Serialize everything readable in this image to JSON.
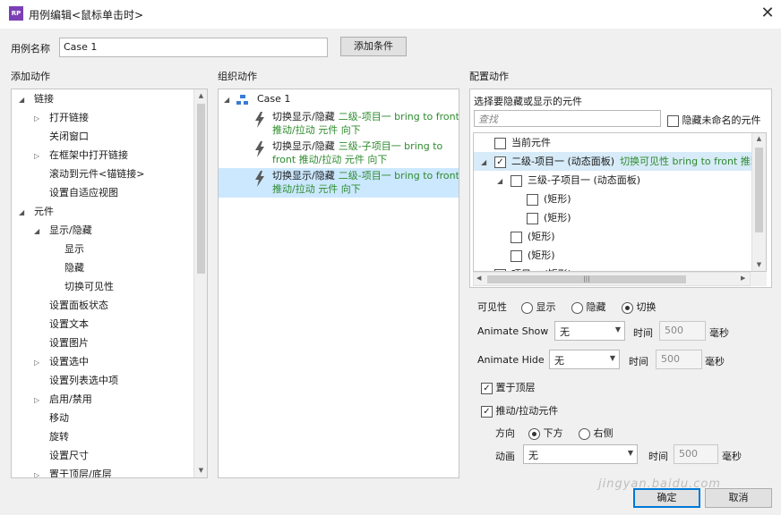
{
  "window": {
    "title": "用例编辑<鼠标单击时>",
    "app_icon": "RP"
  },
  "case_name": {
    "label": "用例名称",
    "value": "Case 1",
    "add_condition": "添加条件"
  },
  "sections": {
    "add_action": "添加动作",
    "organize_action": "组织动作",
    "config_action": "配置动作"
  },
  "add_action_tree": [
    {
      "label": "链接",
      "level": 0,
      "toggle": "expanded"
    },
    {
      "label": "打开链接",
      "level": 1,
      "toggle": "collapsed"
    },
    {
      "label": "关闭窗口",
      "level": 1,
      "toggle": "none"
    },
    {
      "label": "在框架中打开链接",
      "level": 1,
      "toggle": "collapsed"
    },
    {
      "label": "滚动到元件<锚链接>",
      "level": 1,
      "toggle": "none"
    },
    {
      "label": "设置自适应视图",
      "level": 1,
      "toggle": "none"
    },
    {
      "label": "元件",
      "level": 0,
      "toggle": "expanded"
    },
    {
      "label": "显示/隐藏",
      "level": 1,
      "toggle": "expanded"
    },
    {
      "label": "显示",
      "level": 2,
      "toggle": "none"
    },
    {
      "label": "隐藏",
      "level": 2,
      "toggle": "none"
    },
    {
      "label": "切换可见性",
      "level": 2,
      "toggle": "none"
    },
    {
      "label": "设置面板状态",
      "level": 1,
      "toggle": "none"
    },
    {
      "label": "设置文本",
      "level": 1,
      "toggle": "none"
    },
    {
      "label": "设置图片",
      "level": 1,
      "toggle": "none"
    },
    {
      "label": "设置选中",
      "level": 1,
      "toggle": "collapsed"
    },
    {
      "label": "设置列表选中项",
      "level": 1,
      "toggle": "none"
    },
    {
      "label": "启用/禁用",
      "level": 1,
      "toggle": "collapsed"
    },
    {
      "label": "移动",
      "level": 1,
      "toggle": "none"
    },
    {
      "label": "旋转",
      "level": 1,
      "toggle": "none"
    },
    {
      "label": "设置尺寸",
      "level": 1,
      "toggle": "none"
    },
    {
      "label": "置于顶层/底层",
      "level": 1,
      "toggle": "collapsed"
    }
  ],
  "organize": {
    "case_label": "Case 1",
    "actions": [
      {
        "prefix": "切换显示/隐藏",
        "target": "二级-项目一 bring to front",
        "line2": "推动/拉动 元件 向下",
        "selected": false
      },
      {
        "prefix": "切换显示/隐藏",
        "target": "三级-子项目一 bring to",
        "line2": "front 推动/拉动 元件 向下",
        "selected": false
      },
      {
        "prefix": "切换显示/隐藏",
        "target": "二级-项目一 bring to front",
        "line2": "推动/拉动 元件 向下",
        "selected": true
      }
    ]
  },
  "config": {
    "select_label": "选择要隐藏或显示的元件",
    "search_placeholder": "查找",
    "hide_unnamed": "隐藏未命名的元件",
    "widgets": [
      {
        "label": "当前元件",
        "extra": "",
        "level": 0,
        "checked": false,
        "toggle": "none"
      },
      {
        "label": "二级-项目一 (动态面板)",
        "extra": "切换可见性 bring to front 推动/拉",
        "level": 0,
        "checked": true,
        "toggle": "expanded"
      },
      {
        "label": "三级-子项目一 (动态面板)",
        "extra": "",
        "level": 1,
        "checked": false,
        "toggle": "expanded"
      },
      {
        "label": "(矩形)",
        "extra": "",
        "level": 2,
        "checked": false,
        "toggle": "none"
      },
      {
        "label": "(矩形)",
        "extra": "",
        "level": 2,
        "checked": false,
        "toggle": "none"
      },
      {
        "label": "(矩形)",
        "extra": "",
        "level": 1,
        "checked": false,
        "toggle": "none"
      },
      {
        "label": "(矩形)",
        "extra": "",
        "level": 1,
        "checked": false,
        "toggle": "none"
      },
      {
        "label": "项目一 (矩形)",
        "extra": "",
        "level": 0,
        "checked": false,
        "toggle": "none"
      }
    ],
    "visibility": {
      "label": "可见性",
      "options": [
        "显示",
        "隐藏",
        "切换"
      ],
      "selected": "切换"
    },
    "animate_show": {
      "label": "Animate Show",
      "value": "无",
      "time_label": "时间",
      "time_value": "500",
      "unit": "毫秒"
    },
    "animate_hide": {
      "label": "Animate Hide",
      "value": "无",
      "time_label": "时间",
      "time_value": "500",
      "unit": "毫秒"
    },
    "bring_to_front": {
      "label": "置于顶层",
      "checked": true
    },
    "push_pull": {
      "label": "推动/拉动元件",
      "checked": true
    },
    "direction": {
      "label": "方向",
      "options": [
        "下方",
        "右侧"
      ],
      "selected": "下方"
    },
    "animation": {
      "label": "动画",
      "value": "无",
      "time_label": "时间",
      "time_value": "500",
      "unit": "毫秒"
    }
  },
  "buttons": {
    "ok": "确定",
    "cancel": "取消"
  },
  "watermark": "jingyan.baidu.com"
}
